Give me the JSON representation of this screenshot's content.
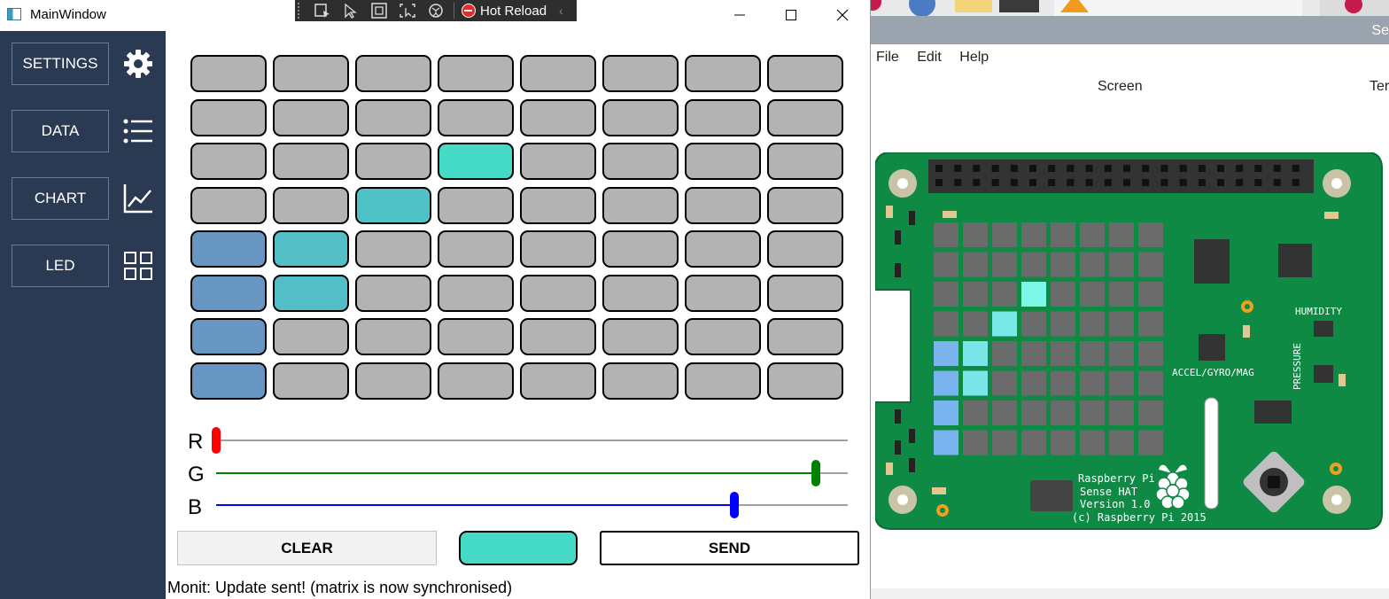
{
  "window": {
    "title": "MainWindow",
    "minimize": "—",
    "maximize": "☐",
    "close": "✕"
  },
  "debug_toolbar": {
    "hot_reload_label": "Hot Reload"
  },
  "sidebar": {
    "items": [
      {
        "label": "SETTINGS",
        "icon": "gear-icon"
      },
      {
        "label": "DATA",
        "icon": "list-icon"
      },
      {
        "label": "CHART",
        "icon": "chart-icon"
      },
      {
        "label": "LED",
        "icon": "grid-icon"
      }
    ]
  },
  "led_matrix": {
    "rows": 8,
    "cols": 8,
    "cells": [
      [
        "#b3b3b3",
        "#b3b3b3",
        "#b3b3b3",
        "#b3b3b3",
        "#b3b3b3",
        "#b3b3b3",
        "#b3b3b3",
        "#b3b3b3"
      ],
      [
        "#b3b3b3",
        "#b3b3b3",
        "#b3b3b3",
        "#b3b3b3",
        "#b3b3b3",
        "#b3b3b3",
        "#b3b3b3",
        "#b3b3b3"
      ],
      [
        "#b3b3b3",
        "#b3b3b3",
        "#b3b3b3",
        "#46dbc6",
        "#b3b3b3",
        "#b3b3b3",
        "#b3b3b3",
        "#b3b3b3"
      ],
      [
        "#b3b3b3",
        "#b3b3b3",
        "#4ec2c6",
        "#b3b3b3",
        "#b3b3b3",
        "#b3b3b3",
        "#b3b3b3",
        "#b3b3b3"
      ],
      [
        "#6796c2",
        "#54bec6",
        "#b3b3b3",
        "#b3b3b3",
        "#b3b3b3",
        "#b3b3b3",
        "#b3b3b3",
        "#b3b3b3"
      ],
      [
        "#6796c2",
        "#54bec6",
        "#b3b3b3",
        "#b3b3b3",
        "#b3b3b3",
        "#b3b3b3",
        "#b3b3b3",
        "#b3b3b3"
      ],
      [
        "#6796c2",
        "#b3b3b3",
        "#b3b3b3",
        "#b3b3b3",
        "#b3b3b3",
        "#b3b3b3",
        "#b3b3b3",
        "#b3b3b3"
      ],
      [
        "#6796c2",
        "#b3b3b3",
        "#b3b3b3",
        "#b3b3b3",
        "#b3b3b3",
        "#b3b3b3",
        "#b3b3b3",
        "#b3b3b3"
      ]
    ]
  },
  "sliders": [
    {
      "label": "R",
      "value": 0.0,
      "color": "#ff0000"
    },
    {
      "label": "G",
      "value": 0.95,
      "color": "#008000"
    },
    {
      "label": "B",
      "value": 0.82,
      "color": "#0000ff"
    }
  ],
  "buttons": {
    "clear": "CLEAR",
    "send": "SEND",
    "preview_color": "#46dbc6"
  },
  "status": "Monit: Update sent! (matrix is now synchronised)",
  "emulator": {
    "title_fragment": "Se",
    "menu": [
      "File",
      "Edit",
      "Help"
    ],
    "screen_label": "Screen",
    "ter_label": "Ter",
    "board_labels": {
      "humidity": "HUMIDITY",
      "pressure": "PRESSURE",
      "accel": "ACCEL/GYRO/MAG",
      "name1": "Raspberry Pi",
      "name2": "Sense HAT",
      "name3": "Version 1.0",
      "name4": "(c) Raspberry Pi 2015"
    },
    "leds": [
      [
        "#6b6b6b",
        "#6b6b6b",
        "#6b6b6b",
        "#6b6b6b",
        "#6b6b6b",
        "#6b6b6b",
        "#6b6b6b",
        "#6b6b6b"
      ],
      [
        "#6b6b6b",
        "#6b6b6b",
        "#6b6b6b",
        "#6b6b6b",
        "#6b6b6b",
        "#6b6b6b",
        "#6b6b6b",
        "#6b6b6b"
      ],
      [
        "#6b6b6b",
        "#6b6b6b",
        "#6b6b6b",
        "#7af7e6",
        "#6b6b6b",
        "#6b6b6b",
        "#6b6b6b",
        "#6b6b6b"
      ],
      [
        "#6b6b6b",
        "#6b6b6b",
        "#7ae8e6",
        "#6b6b6b",
        "#6b6b6b",
        "#6b6b6b",
        "#6b6b6b",
        "#6b6b6b"
      ],
      [
        "#7ab4ee",
        "#7ae6ea",
        "#6b6b6b",
        "#6b6b6b",
        "#6b6b6b",
        "#6b6b6b",
        "#6b6b6b",
        "#6b6b6b"
      ],
      [
        "#7ab4ee",
        "#7ae6ea",
        "#6b6b6b",
        "#6b6b6b",
        "#6b6b6b",
        "#6b6b6b",
        "#6b6b6b",
        "#6b6b6b"
      ],
      [
        "#7ab4ee",
        "#6b6b6b",
        "#6b6b6b",
        "#6b6b6b",
        "#6b6b6b",
        "#6b6b6b",
        "#6b6b6b",
        "#6b6b6b"
      ],
      [
        "#7ab4ee",
        "#6b6b6b",
        "#6b6b6b",
        "#6b6b6b",
        "#6b6b6b",
        "#6b6b6b",
        "#6b6b6b",
        "#6b6b6b"
      ]
    ]
  }
}
